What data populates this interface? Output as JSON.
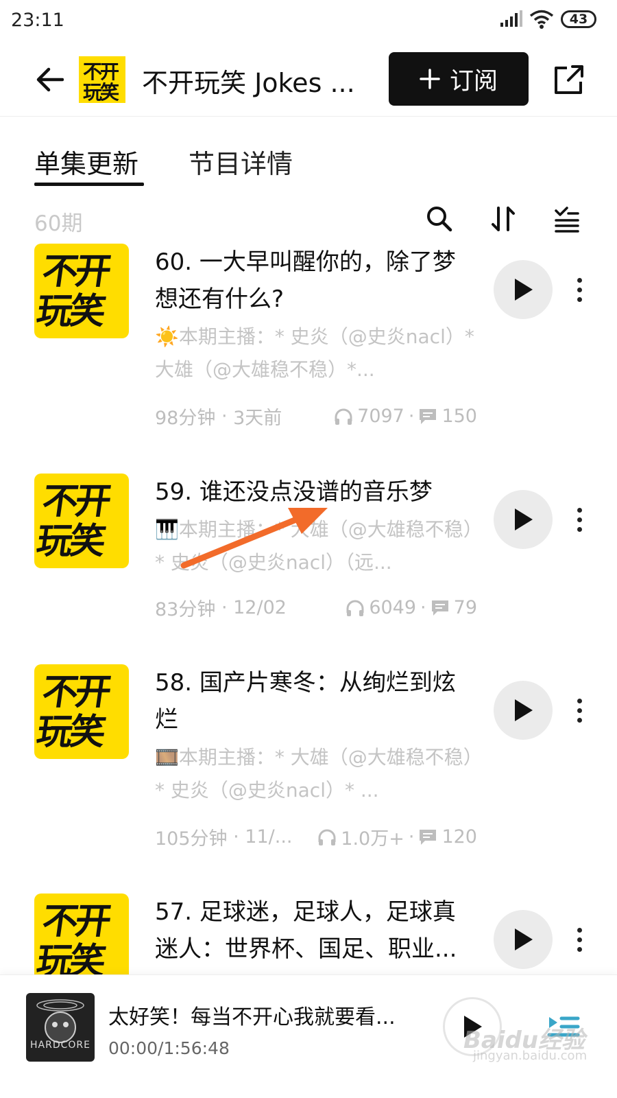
{
  "status_bar": {
    "time": "23:11",
    "battery": "43"
  },
  "header": {
    "podcast_title": "不开玩笑 Jokes ...",
    "subscribe_label": "订阅",
    "logo_text": "不开玩笑"
  },
  "tabs": [
    {
      "label": "单集更新",
      "active": true
    },
    {
      "label": "节目详情",
      "active": false
    }
  ],
  "list": {
    "count_label": "60期"
  },
  "episodes": [
    {
      "title": "60. 一大早叫醒你的，除了梦想还有什么?",
      "desc": "☀️本期主播：* 史炎（@史炎nacl）* 大雄（@大雄稳不稳）*...",
      "duration": "98分钟",
      "date": "3天前",
      "plays": "7097",
      "comments": "150",
      "cover_text": "不开玩笑"
    },
    {
      "title": "59. 谁还没点没谱的音乐梦",
      "desc": "🎹本期主播：* 大雄（@大雄稳不稳）* 史炎（@史炎nacl）（远...",
      "duration": "83分钟",
      "date": "12/02",
      "plays": "6049",
      "comments": "79",
      "cover_text": "不开玩笑"
    },
    {
      "title": "58. 国产片寒冬：从绚烂到炫烂",
      "desc": "🎞️本期主播：* 大雄（@大雄稳不稳）* 史炎（@史炎nacl）* ...",
      "duration": "105分钟",
      "date": "11/...",
      "plays": "1.0万+",
      "comments": "120",
      "cover_text": "不开玩笑"
    },
    {
      "title": "57. 足球迷，足球人，足球真迷人：世界杯、国足、职业...",
      "cover_text": "不开玩笑"
    }
  ],
  "mini_player": {
    "title": "太好笑！每当不开心我就要看...",
    "time": "00:00/1:56:48",
    "cover_text": "HARDCORE"
  },
  "watermark": {
    "brand": "Baidu经验",
    "url": "jingyan.baidu.com"
  },
  "colors": {
    "brand_yellow": "#ffdd00",
    "subscribe_bg": "#111111",
    "annotation_arrow": "#f26b2a",
    "muted_text": "#c4c4c4"
  }
}
